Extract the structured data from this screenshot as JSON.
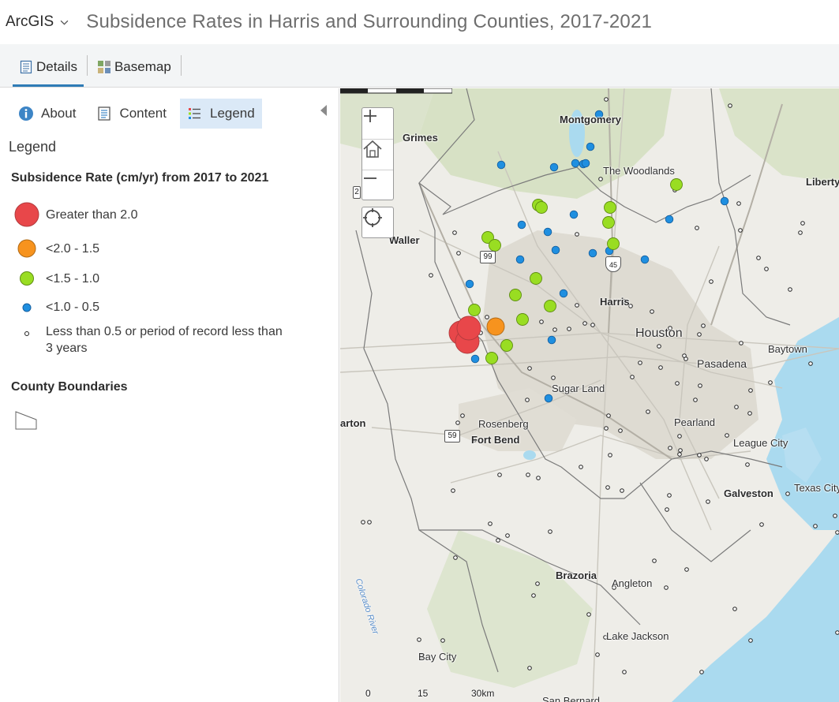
{
  "header": {
    "app_name": "ArcGIS",
    "map_title": "Subsidence Rates in Harris and Surrounding Counties, 2017-2021"
  },
  "toolbar": {
    "details_label": "Details",
    "basemap_label": "Basemap"
  },
  "panel": {
    "tabs": [
      {
        "label": "About",
        "icon": "info-icon"
      },
      {
        "label": "Content",
        "icon": "content-list-icon"
      },
      {
        "label": "Legend",
        "icon": "legend-icon",
        "active": true
      }
    ],
    "legend_heading": "Legend",
    "layers": [
      {
        "title": "Subsidence Rate (cm/yr) from 2017 to 2021",
        "classes": [
          {
            "label": "Greater than 2.0",
            "color": "#e8474a"
          },
          {
            "label": "<2.0 - 1.5",
            "color": "#f7931e"
          },
          {
            "label": "<1.5 - 1.0",
            "color": "#99dd22"
          },
          {
            "label": "<1.0 - 0.5",
            "color": "#1f8fe0"
          },
          {
            "label": "Less than 0.5 or period of record less than 3 years",
            "color": "#ffffff"
          }
        ]
      },
      {
        "title": "County Boundaries"
      }
    ]
  },
  "map": {
    "colors": {
      "land": "#eeede8",
      "urban": "#dfdcd3",
      "green": "#d4dfc0",
      "water": "#aadaef",
      "boundary": "#7a7a7a"
    },
    "labels": {
      "montgomery": "Montgomery",
      "grimes": "Grimes",
      "the_woodlands": "The Woodlands",
      "liberty": "Liberty",
      "waller": "Waller",
      "harris": "Harris",
      "houston": "Houston",
      "baytown": "Baytown",
      "pasadena": "Pasadena",
      "sugar_land": "Sugar Land",
      "harton": "arton",
      "rosenberg": "Rosenberg",
      "fort_bend": "Fort Bend",
      "pearland": "Pearland",
      "league_city": "League City",
      "texas_city": "Texas City",
      "galveston": "Galveston",
      "brazoria": "Brazoria",
      "angleton": "Angleton",
      "lake_jackson": "Lake Jackson",
      "bay_city": "Bay City",
      "san_bernard": "San Bernard",
      "colorado_river": "Colorado River"
    },
    "shields": {
      "hwy99": "99",
      "i45": "45",
      "us59": "59",
      "hwy2": "2"
    },
    "scale": {
      "zero": "0",
      "mid": "15",
      "end": "30km"
    },
    "controls": [
      "zoom-in",
      "home",
      "zoom-out",
      "locate"
    ]
  }
}
